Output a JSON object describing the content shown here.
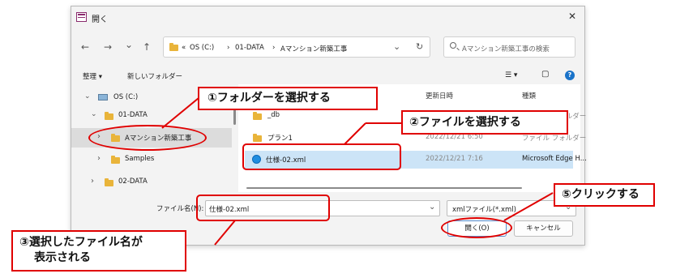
{
  "dialog": {
    "title": "開く",
    "close_glyph": "✕",
    "nav": {
      "back": "←",
      "forward": "→",
      "recent": "⌄",
      "up": "↑",
      "refresh": "↻"
    },
    "address": {
      "prefix": "«",
      "crumbs": [
        "OS (C:)",
        "01-DATA",
        "Aマンション新築工事"
      ],
      "separator": "›",
      "dropdown": "⌄"
    },
    "search": {
      "placeholder": "Aマンション新築工事の検索"
    },
    "toolbar": {
      "organize": "整理 ▾",
      "new_folder": "新しいフォルダー",
      "view": "☰ ▾",
      "pane": "▢",
      "help": "?"
    },
    "nav_pane": {
      "items": [
        {
          "label": "OS (C:)",
          "chevron": "⌄"
        },
        {
          "label": "01-DATA",
          "chevron": "⌄"
        },
        {
          "label": "Aマンション新築工事",
          "chevron": "›"
        },
        {
          "label": "Samples",
          "chevron": "›"
        },
        {
          "label": "02-DATA",
          "chevron": "›"
        }
      ]
    },
    "file_list": {
      "headers": [
        "更新日時",
        "種類"
      ],
      "rows": [
        {
          "name": "_db",
          "date": "",
          "type": "ファイル フォルダー"
        },
        {
          "name": "プラン1",
          "date": "2022/12/21 6:50",
          "type": "ファイル フォルダー"
        },
        {
          "name": "仕様-02.xml",
          "date": "2022/12/21 7:16",
          "type": "Microsoft Edge H..."
        }
      ]
    },
    "filename": {
      "label": "ファイル名(N):",
      "value": "仕様-02.xml",
      "dropdown": "⌄"
    },
    "filter": {
      "value": "xmlファイル(*.xml)",
      "dropdown": "⌄"
    },
    "buttons": {
      "open": "開く(O)",
      "cancel": "キャンセル"
    }
  },
  "callouts": {
    "step1": "①フォルダーを選択する",
    "step2": "②ファイルを選択する",
    "step3_line1": "③選択したファイル名が",
    "step3_line2": "表示される",
    "step5": "⑤クリックする"
  },
  "colors": {
    "callout_border": "#e00000",
    "folder": "#e9b43a",
    "selection": "#cce4f7"
  }
}
